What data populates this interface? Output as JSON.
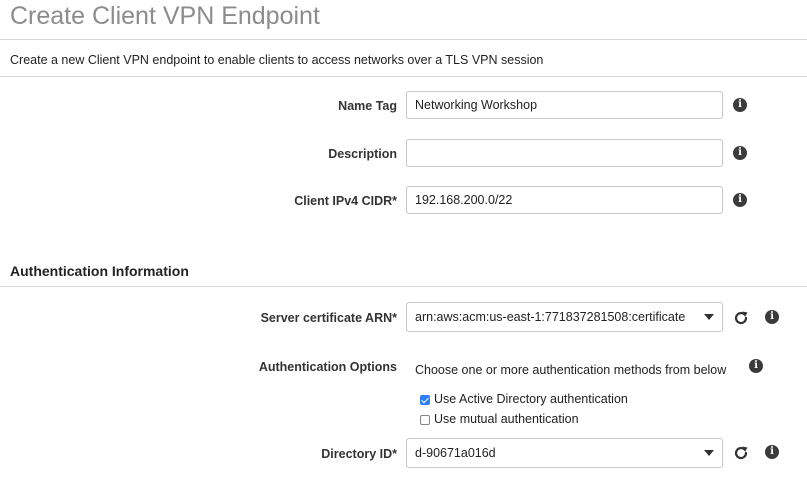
{
  "header": {
    "title": "Create Client VPN Endpoint",
    "subtitle": "Create a new Client VPN endpoint to enable clients to access networks over a TLS VPN session"
  },
  "form": {
    "name_tag": {
      "label": "Name Tag",
      "value": "Networking Workshop",
      "placeholder": ""
    },
    "description": {
      "label": "Description",
      "value": "",
      "placeholder": ""
    },
    "client_cidr": {
      "label": "Client IPv4 CIDR*",
      "value": "192.168.200.0/22",
      "placeholder": ""
    }
  },
  "authentication": {
    "section_title": "Authentication Information",
    "server_cert": {
      "label": "Server certificate ARN*",
      "selected": "arn:aws:acm:us-east-1:771837281508:certificate"
    },
    "options": {
      "label": "Authentication Options",
      "helper": "Choose one or more authentication methods from below",
      "active_directory": {
        "label": "Use Active Directory authentication",
        "checked": true
      },
      "mutual": {
        "label": "Use mutual authentication",
        "checked": false
      }
    },
    "directory_id": {
      "label": "Directory ID*",
      "selected": "d-90671a016d"
    }
  },
  "icons": {
    "info": "info-icon",
    "refresh": "refresh-icon",
    "dropdown": "chevron-down-icon"
  },
  "colors": {
    "title": "#8c8c8c",
    "checkbox_accent": "#2d7ff9"
  }
}
